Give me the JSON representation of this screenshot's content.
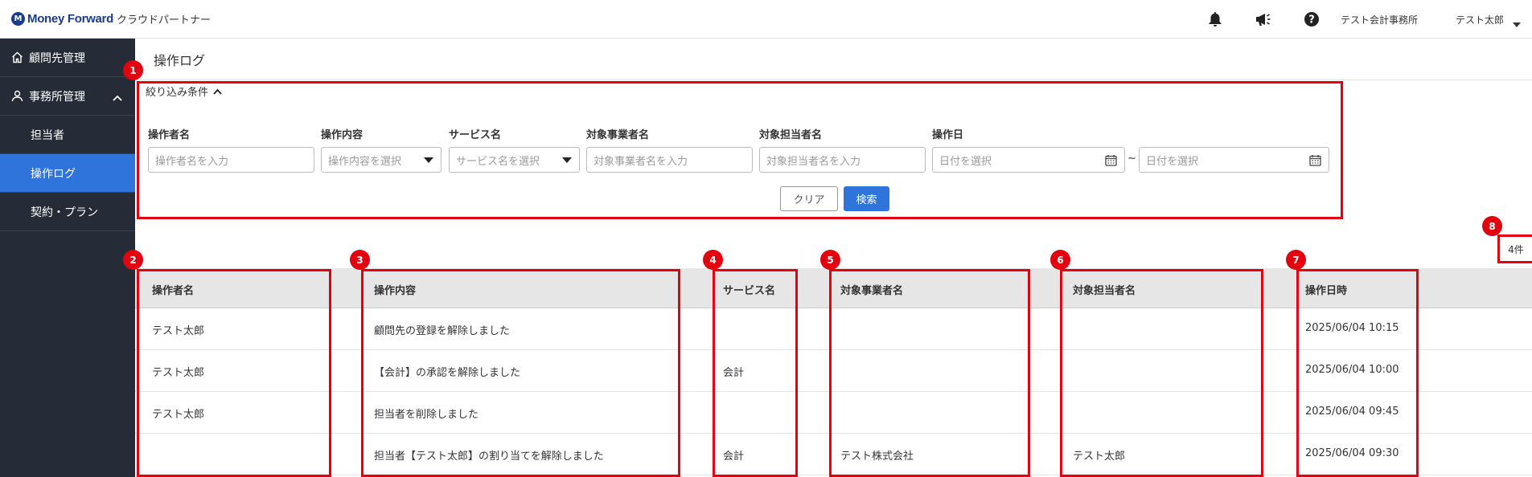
{
  "header": {
    "brand_mark": "M",
    "brand_name": "Money Forward",
    "product_name": "クラウドパートナー",
    "office_name": "テスト会計事務所",
    "user_name": "テスト太郎",
    "icons": [
      "bell-icon",
      "megaphone-icon",
      "help-icon",
      "chevron-down-icon"
    ]
  },
  "sidebar": {
    "items": [
      {
        "label": "顧問先管理",
        "icon": "home-icon"
      },
      {
        "label": "事務所管理",
        "icon": "person-icon",
        "expanded": true
      },
      {
        "label": "担当者"
      },
      {
        "label": "操作ログ",
        "active": true
      },
      {
        "label": "契約・プラン"
      }
    ]
  },
  "main": {
    "page_title": "操作ログ"
  },
  "filter": {
    "toggle_label": "絞り込み条件",
    "fields": [
      {
        "label": "操作者名",
        "placeholder": "操作者名を入力"
      },
      {
        "label": "操作内容",
        "placeholder": "操作内容を選択"
      },
      {
        "label": "サービス名",
        "placeholder": "サービス名を選択"
      },
      {
        "label": "対象事業者名",
        "placeholder": "対象事業者名を入力"
      },
      {
        "label": "対象担当者名",
        "placeholder": "対象担当者名を入力"
      },
      {
        "label": "操作日",
        "placeholder_from": "日付を選択",
        "placeholder_to": "日付を選択"
      }
    ],
    "range_separator": "~",
    "clear_label": "クリア",
    "search_label": "検索"
  },
  "result_count": "4件",
  "table": {
    "headers": [
      "操作者名",
      "操作内容",
      "サービス名",
      "対象事業者名",
      "対象担当者名",
      "操作日時"
    ],
    "rows": [
      [
        "テスト太郎",
        "顧問先の登録を解除しました",
        "",
        "",
        "",
        "2025/06/04 10:15"
      ],
      [
        "テスト太郎",
        "【会計】の承認を解除しました",
        "会計",
        "",
        "",
        "2025/06/04 10:00"
      ],
      [
        "テスト太郎",
        "担当者を削除しました",
        "",
        "",
        "",
        "2025/06/04 09:45"
      ],
      [
        "",
        "担当者【テスト太郎】の割り当てを解除しました",
        "会計",
        "テスト株式会社",
        "テスト太郎",
        "2025/06/04 09:30"
      ]
    ]
  },
  "annotations": {
    "markers": [
      "1",
      "2",
      "3",
      "4",
      "5",
      "6",
      "7",
      "8"
    ],
    "color": "#e3000f"
  },
  "colors": {
    "accent": "#2f74db",
    "sidebar": "#252c37",
    "annotation": "#e3000f"
  }
}
